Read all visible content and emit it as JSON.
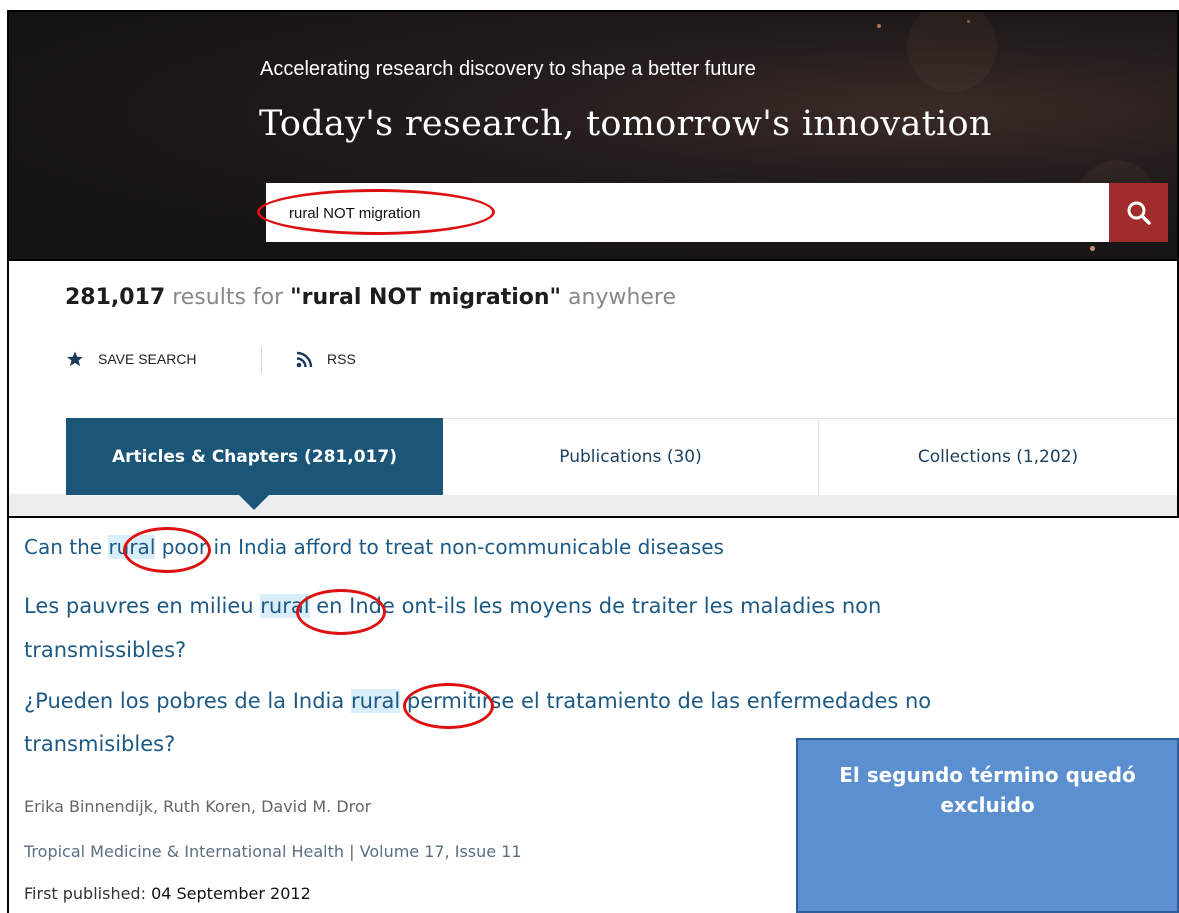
{
  "hero": {
    "tagline": "Accelerating research discovery to shape a better future",
    "title": "Today's research, tomorrow's innovation",
    "search_value": "rural NOT migration",
    "search_icon": "magnifier-icon",
    "accent": "#a02c2c"
  },
  "results": {
    "count": "281,017",
    "text": "results for",
    "query": "\"rural NOT migration\"",
    "scope": "anywhere",
    "save_search_label": "SAVE SEARCH",
    "rss_label": "RSS"
  },
  "tabs": [
    {
      "label": "Articles & Chapters (281,017)",
      "active": true
    },
    {
      "label": "Publications (30)",
      "active": false
    },
    {
      "label": "Collections (1,202)",
      "active": false
    }
  ],
  "article": {
    "title_en": {
      "pre": "Can the ",
      "hl": "rural",
      "post": " poor in India afford to treat non-communicable diseases"
    },
    "title_fr": {
      "pre": "Les pauvres en milieu ",
      "hl": "rural",
      "post": " en Inde ont-ils les moyens de traiter les maladies non",
      "cont": "transmissibles?"
    },
    "title_es": {
      "pre": "¿Pueden los pobres de la India ",
      "hl": "rural",
      "post": " permitirse el tratamiento de las enfermedades no",
      "cont": "transmisibles?"
    },
    "authors": "Erika Binnendijk, Ruth Koren, David M. Dror",
    "journal": "Tropical Medicine & International Health",
    "volume": "Volume 17, Issue 11",
    "published_label": "First published:",
    "published_date": "04 September 2012"
  },
  "note": {
    "text": "El segundo término quedó excluido",
    "color": "#5b8fcf"
  },
  "colors": {
    "link": "#1c5a85",
    "tab_active": "#1b5577",
    "highlight": "#d9eef9",
    "annotation": "#dd1111"
  }
}
